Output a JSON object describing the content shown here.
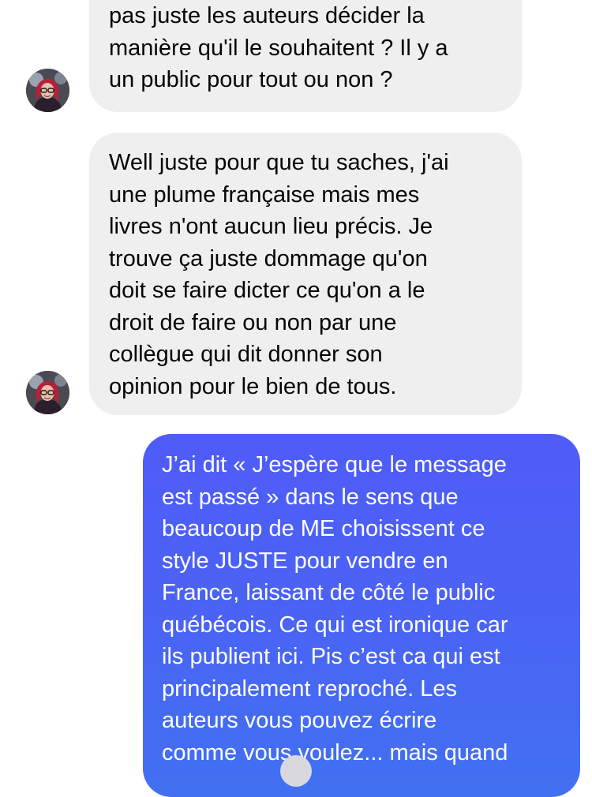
{
  "conversation": {
    "messages": [
      {
        "direction": "incoming",
        "text": "pas juste les auteurs décider la\nmanière qu'il le souhaitent ? Il y a\nun public pour tout ou non ?"
      },
      {
        "direction": "incoming",
        "text": "Well juste pour que tu saches, j'ai\nune plume française mais mes\nlivres n'ont aucun lieu précis. Je\ntrouve ça juste dommage qu'on\ndoit se faire dicter ce qu'on a le\ndroit de faire ou non par une\ncollègue qui dit donner son\nopinion pour le bien de tous."
      },
      {
        "direction": "outgoing",
        "text": "J’ai dit « J’espère que le message\nest passé » dans le sens que\nbeaucoup de ME choisissent ce\nstyle JUSTE pour vendre en\nFrance, laissant de côté le public\nquébécois. Ce qui est ironique car\nils publient ici. Pis c’est ca qui est\nprincipalement reproché. Les\nauteurs vous pouvez écrire\ncomme vous voulez... mais quand"
      }
    ]
  },
  "colors": {
    "incoming_bubble": "#efeff0",
    "incoming_text": "#050505",
    "outgoing_gradient_top": "#4f5cf7",
    "outgoing_gradient_bottom": "#4171f1",
    "outgoing_text": "#ffffff"
  },
  "icons": {
    "avatar": "contact-avatar-photo"
  }
}
